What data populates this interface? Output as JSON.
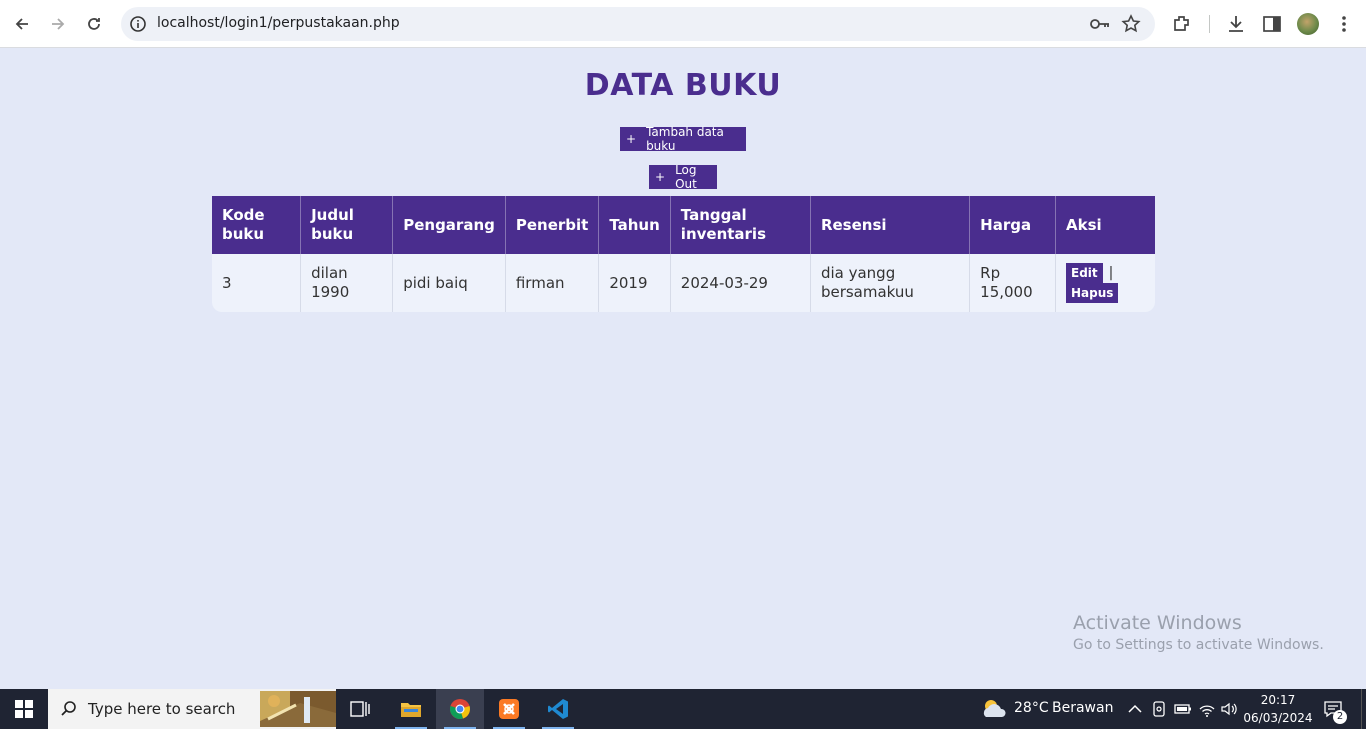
{
  "browser": {
    "url": "localhost/login1/perpustakaan.php"
  },
  "page": {
    "title": "DATA BUKU",
    "add_button": "Tambah data buku",
    "logout_button": "Log Out",
    "button_prefix": "+"
  },
  "table": {
    "headers": [
      "Kode buku",
      "Judul buku",
      "Pengarang",
      "Penerbit",
      "Tahun",
      "Tanggal inventaris",
      "Resensi",
      "Harga",
      "Aksi"
    ],
    "rows": [
      {
        "kode": "3",
        "judul": "dilan 1990",
        "pengarang": "pidi baiq",
        "penerbit": "firman",
        "tahun": "2019",
        "tanggal": "2024-03-29",
        "resensi": "dia yangg bersamakuu",
        "harga": "Rp 15,000",
        "edit": "Edit",
        "separator": "|",
        "hapus": "Hapus"
      }
    ]
  },
  "watermark": {
    "title": "Activate Windows",
    "subtitle": "Go to Settings to activate Windows."
  },
  "taskbar": {
    "search_placeholder": "Type here to search",
    "weather": "28°C",
    "weather_desc": "Berawan",
    "time": "20:17",
    "date": "06/03/2024",
    "notifications": "2"
  },
  "colors": {
    "accent": "#4a2d8e",
    "page_bg": "#e3e8f7",
    "row_bg": "#eef2fb"
  }
}
